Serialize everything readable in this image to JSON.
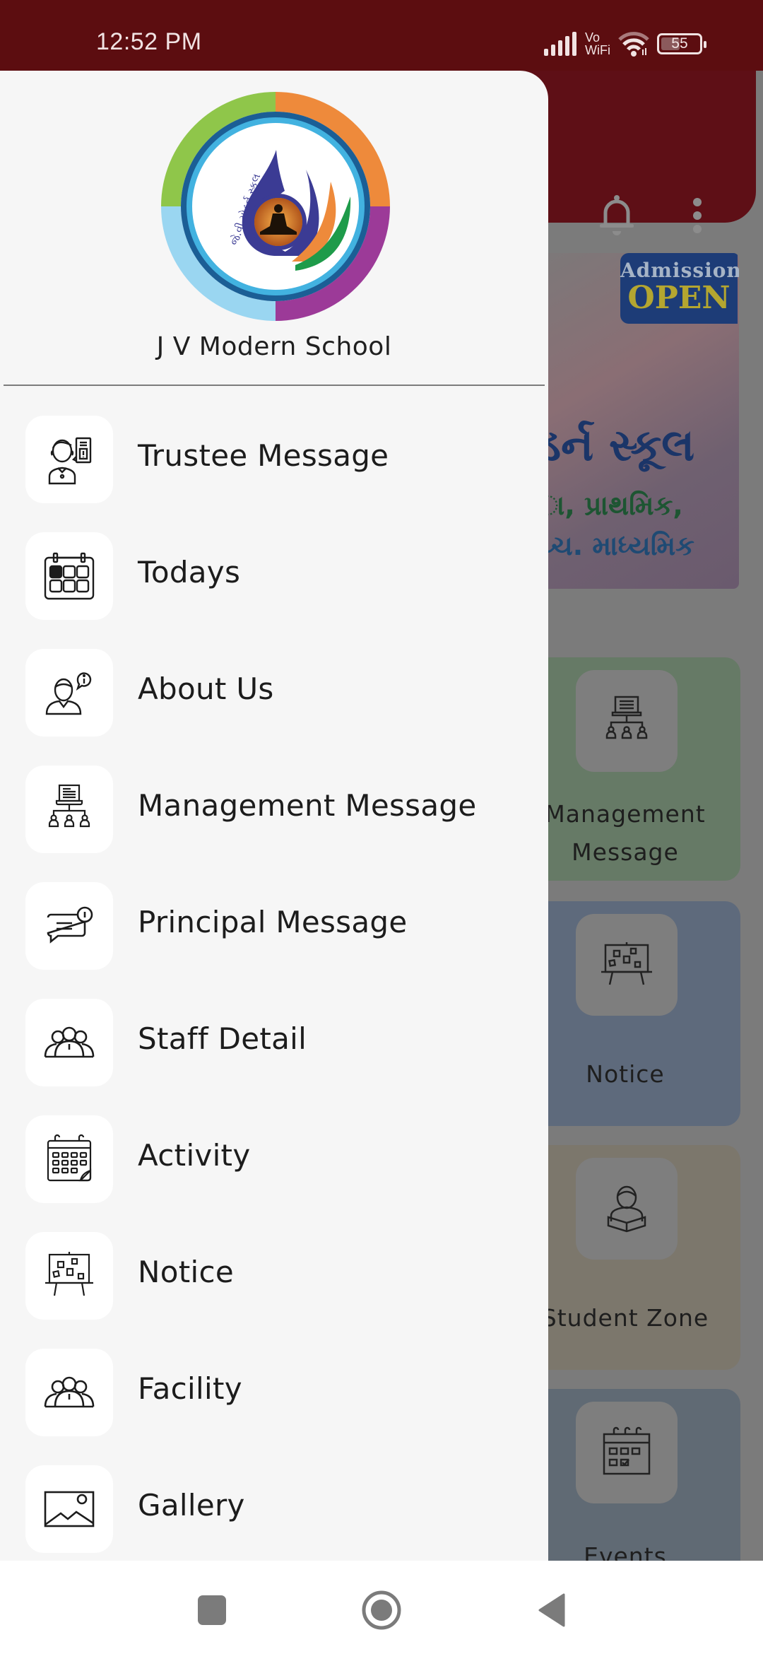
{
  "status_bar": {
    "time": "12:52 PM",
    "network_label_top": "Vo",
    "network_label_bottom": "WiFi",
    "battery_level": "55",
    "battery_fraction": 0.55
  },
  "background_app": {
    "header_icons": [
      "bell-icon",
      "more-vert-icon"
    ],
    "banner": {
      "badge_line1": "Admission",
      "badge_line2": "OPEN",
      "line1": "ડર્ન સ્કૂલ",
      "line2": "ા, પ્રાથમિક,",
      "line3": "ચ્ચ. માધ્યમિક"
    },
    "cards": [
      {
        "label": "Management\nMessage",
        "icon": "management-icon",
        "color": "#667a66"
      },
      {
        "label": "Notice",
        "icon": "notice-board-icon",
        "color": "#5e6a7c"
      },
      {
        "label": "Student Zone",
        "icon": "student-icon",
        "color": "#7c776c"
      },
      {
        "label": "Events",
        "icon": "events-calendar-icon",
        "color": "#606a74"
      }
    ]
  },
  "drawer": {
    "school_name": "J V Modern School",
    "logo_text": "જે.વી.મોડર્ન સ્કૂલ",
    "menu": [
      {
        "label": "Trustee Message",
        "icon": "trustee-icon"
      },
      {
        "label": "Todays",
        "icon": "calendar-today-icon"
      },
      {
        "label": "About Us",
        "icon": "about-us-icon"
      },
      {
        "label": "Management Message",
        "icon": "management-icon"
      },
      {
        "label": "Principal Message",
        "icon": "message-alert-icon"
      },
      {
        "label": "Staff Detail",
        "icon": "staff-group-icon"
      },
      {
        "label": "Activity",
        "icon": "activity-calendar-icon"
      },
      {
        "label": "Notice",
        "icon": "notice-board-icon"
      },
      {
        "label": "Facility",
        "icon": "facility-group-icon"
      },
      {
        "label": "Gallery",
        "icon": "gallery-image-icon"
      }
    ]
  },
  "nav_bar": {
    "buttons": [
      "recents",
      "home",
      "back"
    ]
  }
}
